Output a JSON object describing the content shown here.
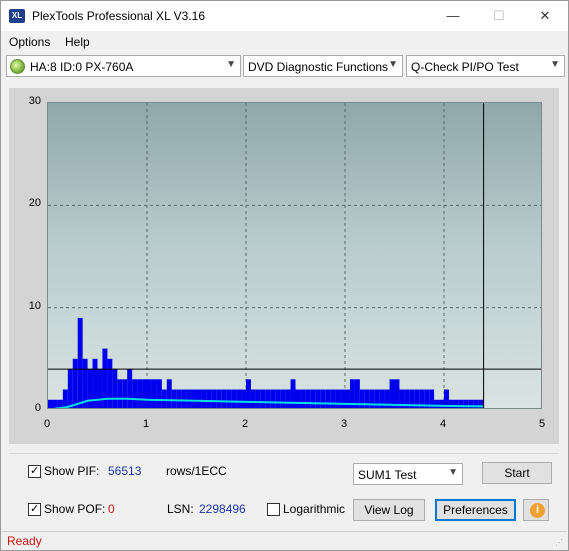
{
  "window": {
    "title": "PlexTools Professional XL V3.16",
    "app_icon_text": "XL",
    "min_glyph": "—",
    "max_glyph": "☐",
    "close_glyph": "✕"
  },
  "menu": {
    "options": "Options",
    "help": "Help"
  },
  "toolbar": {
    "drive": "HA:8 ID:0  PX-760A",
    "function": "DVD Diagnostic Functions",
    "test": "Q-Check PI/PO Test",
    "arrow_glyph": "▼"
  },
  "chart_data": {
    "type": "bar",
    "title": "",
    "xlabel": "",
    "ylabel": "",
    "xlim": [
      0,
      5
    ],
    "ylim": [
      0,
      30
    ],
    "x_ticks": [
      "0",
      "1",
      "2",
      "3",
      "4",
      "5"
    ],
    "y_ticks": [
      "0",
      "10",
      "20",
      "30"
    ],
    "grid": true,
    "threshold_line": 4,
    "end_marker_x": 4.4,
    "series": [
      {
        "color": "#0000ee",
        "x": [
          0.05,
          0.1,
          0.15,
          0.2,
          0.25,
          0.3,
          0.35,
          0.4,
          0.45,
          0.5,
          0.55,
          0.6,
          0.65,
          0.7,
          0.75,
          0.8,
          0.85,
          0.9,
          0.95,
          1.0,
          1.05,
          1.1,
          1.15,
          1.2,
          1.25,
          1.3,
          1.35,
          1.4,
          1.45,
          1.5,
          1.55,
          1.6,
          1.65,
          1.7,
          1.75,
          1.8,
          1.85,
          1.9,
          1.95,
          2.0,
          2.05,
          2.1,
          2.15,
          2.2,
          2.25,
          2.3,
          2.35,
          2.4,
          2.45,
          2.5,
          2.55,
          2.6,
          2.65,
          2.7,
          2.75,
          2.8,
          2.85,
          2.9,
          2.95,
          3.0,
          3.05,
          3.1,
          3.15,
          3.2,
          3.25,
          3.3,
          3.35,
          3.4,
          3.45,
          3.5,
          3.55,
          3.6,
          3.65,
          3.7,
          3.75,
          3.8,
          3.85,
          3.9,
          3.95,
          4.0,
          4.05,
          4.1,
          4.15,
          4.2,
          4.25,
          4.3,
          4.35,
          4.4
        ],
        "values": [
          1,
          1,
          1,
          2,
          4,
          5,
          9,
          5,
          4,
          5,
          4,
          6,
          5,
          4,
          3,
          3,
          4,
          3,
          3,
          3,
          3,
          3,
          3,
          2,
          3,
          2,
          2,
          2,
          2,
          2,
          2,
          2,
          2,
          2,
          2,
          2,
          2,
          2,
          2,
          2,
          3,
          2,
          2,
          2,
          2,
          2,
          2,
          2,
          2,
          3,
          2,
          2,
          2,
          2,
          2,
          2,
          2,
          2,
          2,
          2,
          2,
          3,
          3,
          2,
          2,
          2,
          2,
          2,
          2,
          3,
          3,
          2,
          2,
          2,
          2,
          2,
          2,
          2,
          1,
          1,
          2,
          1,
          1,
          1,
          1,
          1,
          1,
          1
        ]
      },
      {
        "color": "#00e0e0",
        "x": [
          0.05,
          0.2,
          0.3,
          0.4,
          0.5,
          0.6,
          0.8,
          1.0,
          1.5,
          2.0,
          2.5,
          3.0,
          3.5,
          4.0,
          4.4
        ],
        "values": [
          0.1,
          0.3,
          0.6,
          0.9,
          1.0,
          1.1,
          1.1,
          1.0,
          0.9,
          0.8,
          0.7,
          0.6,
          0.5,
          0.4,
          0.35
        ]
      }
    ]
  },
  "controls": {
    "show_pif_label": "Show PIF:",
    "pif_value": "56513",
    "pif_unit": "rows/1ECC",
    "show_pof_label": "Show POF:",
    "pof_value": "0",
    "lsn_label": "LSN:",
    "lsn_value": "2298496",
    "logarithmic_label": "Logarithmic",
    "sum_test": "SUM1 Test",
    "start_button": "Start",
    "view_log_button": "View Log",
    "preferences_button": "Preferences",
    "info_glyph": "i"
  },
  "status": {
    "text": "Ready"
  }
}
